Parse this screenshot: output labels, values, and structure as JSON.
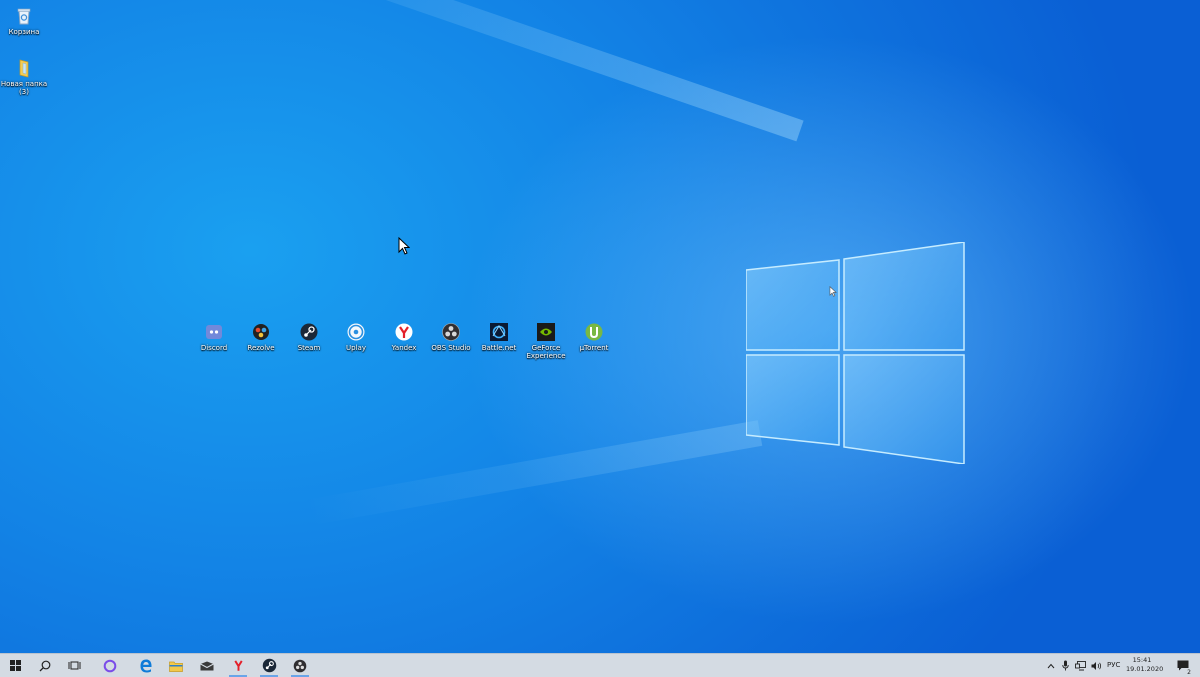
{
  "desktop": {
    "left_icons": [
      {
        "name": "recycle-bin",
        "label": "Корзина"
      },
      {
        "name": "new-folder",
        "label": "Новая папка (3)"
      }
    ],
    "row_icons": [
      {
        "name": "discord",
        "label": "Discord",
        "color": "#7289da"
      },
      {
        "name": "rezolve",
        "label": "Rezolve",
        "color": "#222222"
      },
      {
        "name": "steam",
        "label": "Steam",
        "color": "#1b2838"
      },
      {
        "name": "uplay",
        "label": "Uplay",
        "color": "#2a8fe0"
      },
      {
        "name": "yandex",
        "label": "Yandex",
        "color": "#e4202a"
      },
      {
        "name": "obs-studio",
        "label": "OBS Studio",
        "color": "#302e31"
      },
      {
        "name": "battle-net",
        "label": "Battle.net",
        "color": "#0e3b6e"
      },
      {
        "name": "geforce-experience",
        "label": "GeForce Experience",
        "color": "#76b900"
      },
      {
        "name": "utorrent",
        "label": "µTorrent",
        "color": "#78b843"
      }
    ]
  },
  "taskbar": {
    "tray": {
      "language": "РУС",
      "time": "15:41",
      "date": "19.01.2020",
      "notification_count": "2"
    }
  }
}
